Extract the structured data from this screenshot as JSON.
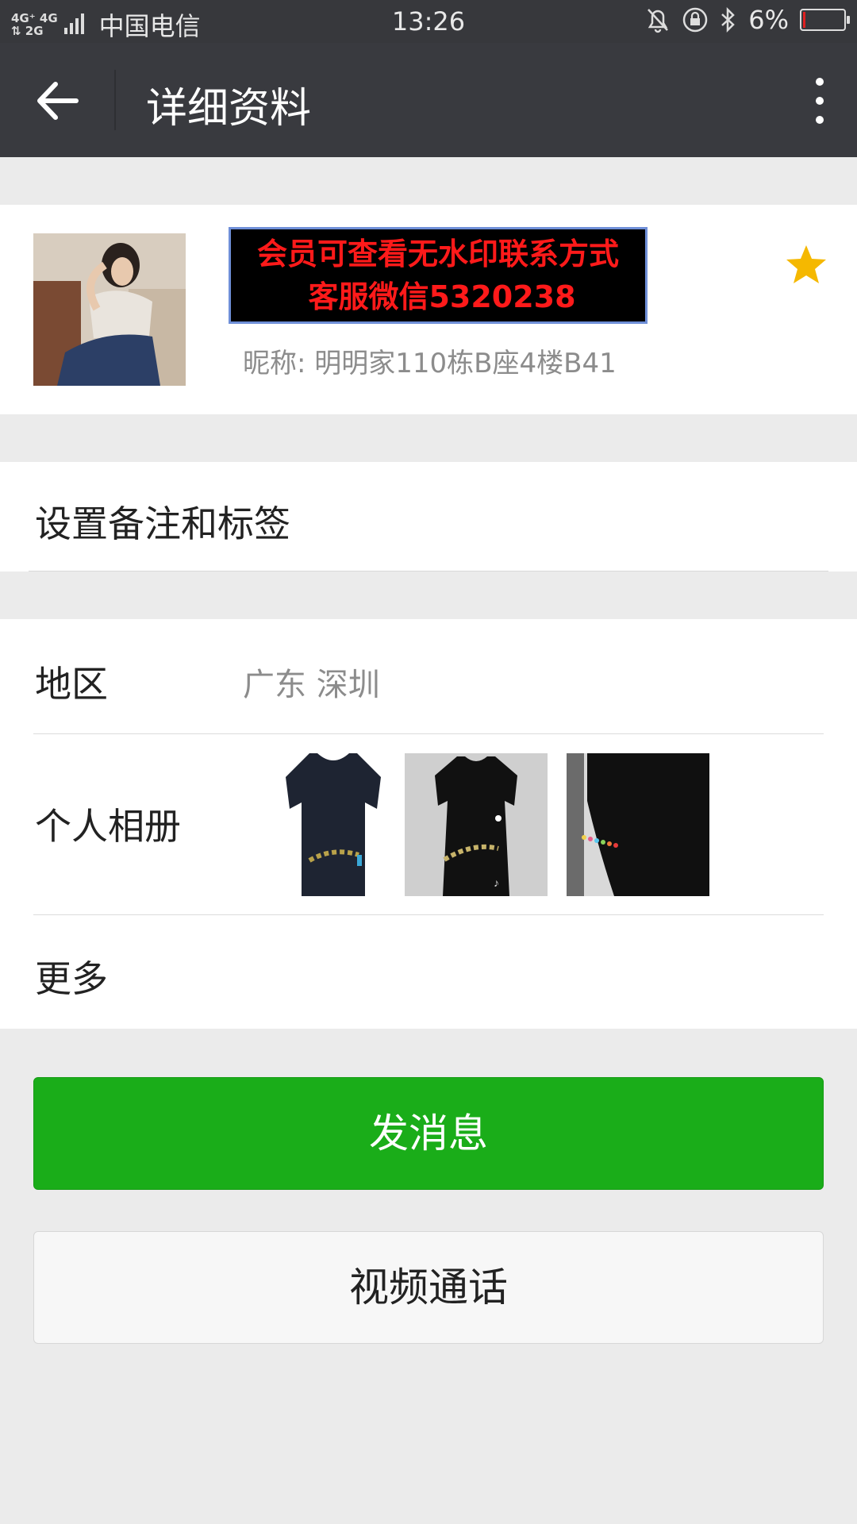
{
  "status_bar": {
    "network_top": "4G⁺ 4G",
    "network_bottom": "⇅ 2G",
    "carrier": "中国电信",
    "time": "13:26",
    "battery": "6%",
    "battery_level": 0.06,
    "battery_color": "#e02020"
  },
  "app_bar": {
    "title": "详细资料",
    "back_icon": "arrow-left-icon",
    "more_icon": "more-vertical-icon"
  },
  "profile": {
    "watermark_line1": "会员可查看无水印联系方式",
    "watermark_line2": "客服微信5320238",
    "nickname": "昵称: 明明家110栋B座4楼B41",
    "star_icon": "star-icon",
    "star_color": "#f5b800"
  },
  "remark": {
    "label": "设置备注和标签"
  },
  "info": {
    "region_label": "地区",
    "region_value": "广东  深圳",
    "album_label": "个人相册",
    "album_photos": [
      "dress-photo-1",
      "dress-photo-2",
      "sleeve-photo-3"
    ],
    "more_label": "更多"
  },
  "actions": {
    "send_message": "发消息",
    "video_call": "视频通话",
    "accent_color": "#1aad19"
  }
}
